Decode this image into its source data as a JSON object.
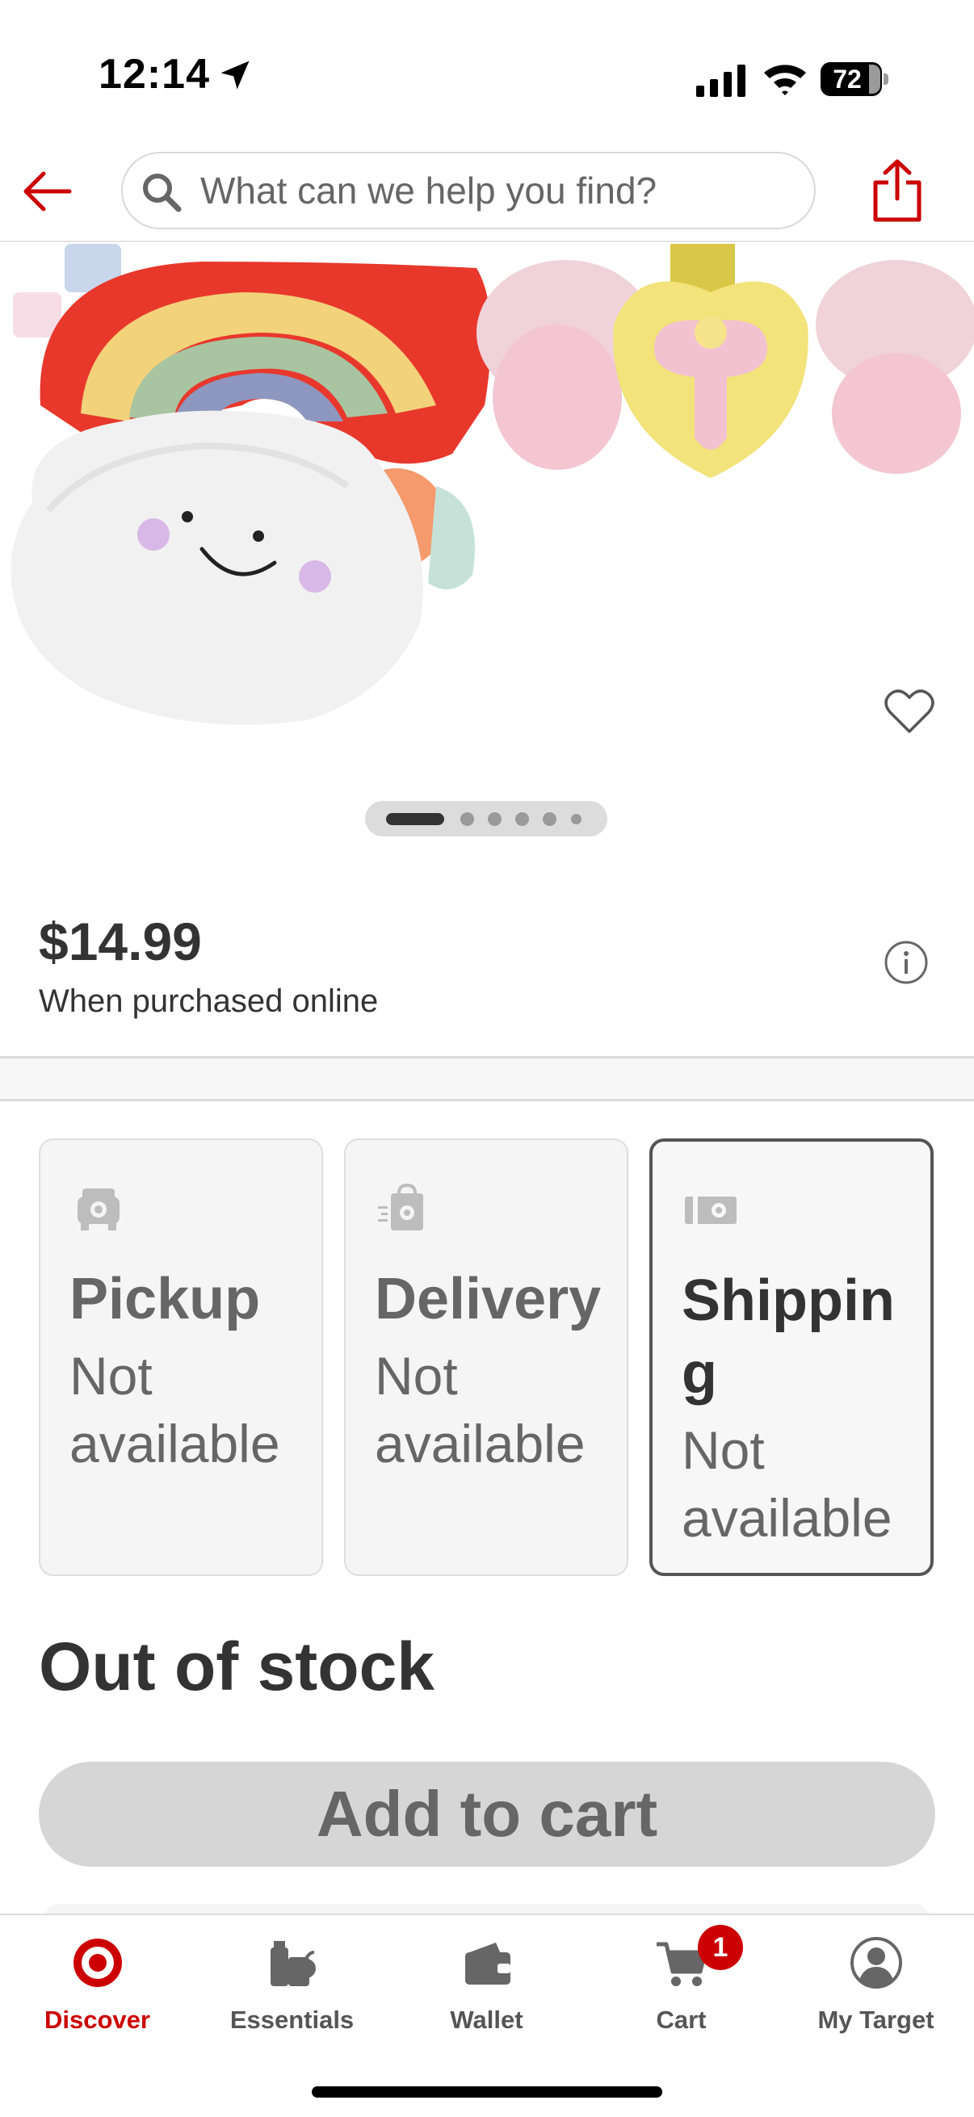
{
  "status_bar": {
    "time": "12:14",
    "battery": "72"
  },
  "header": {
    "search_placeholder": "What can we help you find?",
    "brand_color": "#cc0000"
  },
  "gallery": {
    "image_count": 6,
    "active_index": 0
  },
  "product": {
    "price": "$14.99",
    "price_note": "When purchased online"
  },
  "fulfillment": [
    {
      "title": "Pickup",
      "status": "Not available",
      "icon": "pickup-car-icon",
      "selected": false
    },
    {
      "title": "Delivery",
      "status": "Not available",
      "icon": "delivery-bag-icon",
      "selected": false
    },
    {
      "title": "Shipping",
      "status": "Not available",
      "icon": "shipping-truck-icon",
      "selected": true
    }
  ],
  "stock_status": "Out of stock",
  "add_to_cart_label": "Add to cart",
  "bottom_nav": {
    "items": [
      {
        "label": "Discover",
        "icon": "bullseye-icon",
        "active": true
      },
      {
        "label": "Essentials",
        "icon": "essentials-icon",
        "active": false
      },
      {
        "label": "Wallet",
        "icon": "wallet-icon",
        "active": false
      },
      {
        "label": "Cart",
        "icon": "cart-icon",
        "active": false
      },
      {
        "label": "My Target",
        "icon": "account-icon",
        "active": false
      }
    ],
    "cart_count": "1"
  }
}
